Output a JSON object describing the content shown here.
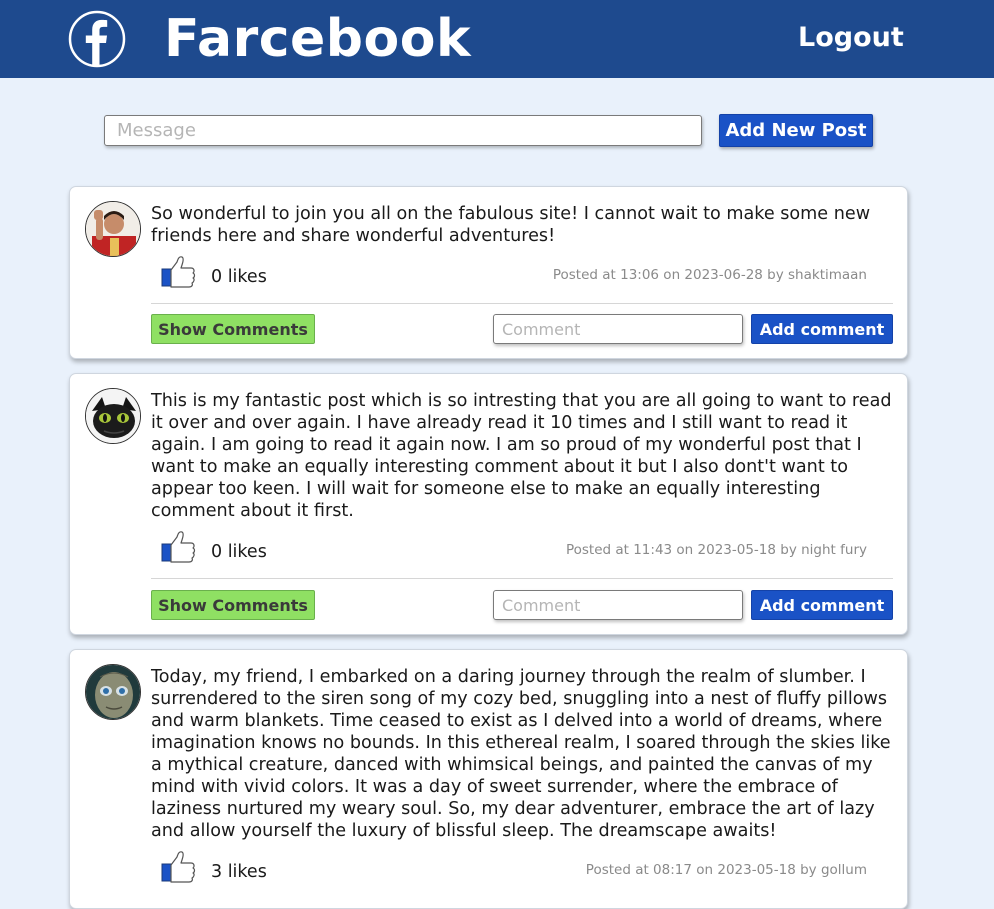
{
  "header": {
    "brand": "Farcebook",
    "logout_label": "Logout",
    "logo_icon": "facebook-f-icon",
    "background_color": "#1e4a8e"
  },
  "new_post": {
    "placeholder": "Message",
    "button_label": "Add New Post"
  },
  "posts": [
    {
      "avatar_icon": "user-avatar-red-costume",
      "text": "So wonderful to join you all on the fabulous site! I cannot wait to make some new friends here and share wonderful adventures!",
      "likes": "0 likes",
      "meta": "Posted at 13:06 on 2023-06-28 by shaktimaan",
      "show_comments_label": "Show Comments",
      "comment_placeholder": "Comment",
      "add_comment_label": "Add comment"
    },
    {
      "avatar_icon": "user-avatar-black-dragon",
      "text": "This is my fantastic post which is so intresting that you are all going to want to read it over and over again. I have already read it 10 times and I still want to read it again. I am going to read it again now. I am so proud of my wonderful post that I want to make an equally interesting comment about it but I also dont't want to appear too keen. I will wait for someone else to make an equally interesting comment about it first.",
      "likes": "0 likes",
      "meta": "Posted at 11:43 on 2023-05-18 by night fury",
      "show_comments_label": "Show Comments",
      "comment_placeholder": "Comment",
      "add_comment_label": "Add comment"
    },
    {
      "avatar_icon": "user-avatar-gollum",
      "text": "Today, my friend, I embarked on a daring journey through the realm of slumber. I surrendered to the siren song of my cozy bed, snuggling into a nest of fluffy pillows and warm blankets. Time ceased to exist as I delved into a world of dreams, where imagination knows no bounds. In this ethereal realm, I soared through the skies like a mythical creature, danced with whimsical beings, and painted the canvas of my mind with vivid colors. It was a day of sweet surrender, where the embrace of laziness nurtured my weary soul. So, my dear adventurer, embrace the art of lazy and allow yourself the luxury of blissful sleep. The dreamscape awaits!",
      "likes": "3 likes",
      "meta": "Posted at 08:17 on 2023-05-18 by gollum"
    }
  ],
  "colors": {
    "page_background": "#e9f1fb",
    "primary_button": "#1a52c6",
    "show_comments_button": "#8fe063"
  }
}
